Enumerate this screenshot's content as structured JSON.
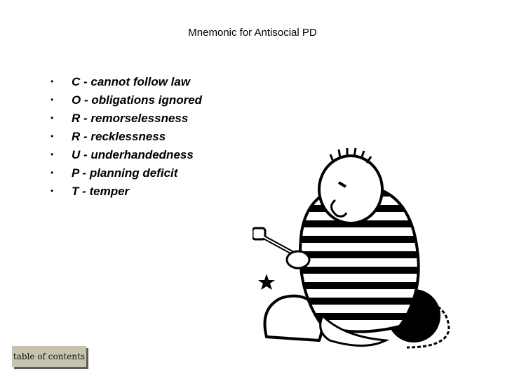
{
  "slide": {
    "title": "Mnemonic for Antisocial PD",
    "items": [
      {
        "bullet": "•",
        "text": "C - cannot follow law"
      },
      {
        "bullet": "•",
        "text": "O - obligations ignored"
      },
      {
        "bullet": "•",
        "text": "R - remorselessness"
      },
      {
        "bullet": "•",
        "text": "R - recklessness"
      },
      {
        "bullet": "•",
        "text": "U - underhandedness"
      },
      {
        "bullet": "•",
        "text": "P - planning deficit"
      },
      {
        "bullet": "•",
        "text": "T - temper"
      }
    ],
    "illustration": "prisoner-cartoon",
    "toc_button": "table of contents"
  }
}
